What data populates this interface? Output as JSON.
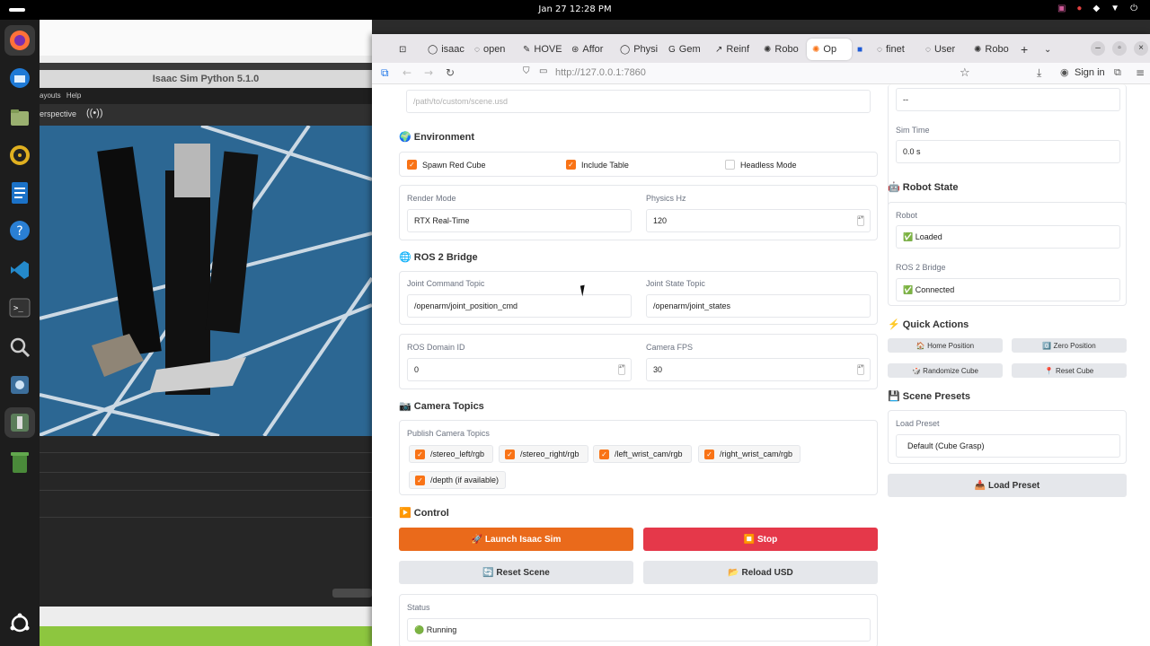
{
  "topbar": {
    "datetime": "Jan 27  12:28 PM",
    "tray": [
      "▣",
      "●",
      "◆",
      "▼",
      "⏻"
    ]
  },
  "dock": {
    "items": [
      "firefox-icon",
      "thunderbird-icon",
      "files-icon",
      "rhythmbox-icon",
      "writer-icon",
      "help-icon",
      "vscode-icon",
      "terminal-icon",
      "search-icon",
      "isaac-app-icon",
      "isaac-sim-icon",
      "trash-icon",
      "ubuntu-logo-icon"
    ]
  },
  "sim": {
    "title": "Isaac Sim Python 5.1.0",
    "menu": [
      "ayouts",
      "Help"
    ],
    "viewport_mode": "erspective",
    "camera_glyph": "((•))"
  },
  "browser": {
    "tabs": [
      {
        "icon": "⊡",
        "label": ""
      },
      {
        "icon": "◯",
        "label": "isaac"
      },
      {
        "icon": "◌",
        "label": "open"
      },
      {
        "icon": "✎",
        "label": "HOVE"
      },
      {
        "icon": "⊛",
        "label": "Affor"
      },
      {
        "icon": "◯",
        "label": "Physi"
      },
      {
        "icon": "G",
        "label": "Gem"
      },
      {
        "icon": "↗",
        "label": "Reinf"
      },
      {
        "icon": "✺",
        "label": "Robo"
      },
      {
        "icon": "✺",
        "label": "Op"
      },
      {
        "icon": "■",
        "label": ""
      },
      {
        "icon": "◌",
        "label": "finet"
      },
      {
        "icon": "◌",
        "label": "User"
      },
      {
        "icon": "✺",
        "label": "Robo"
      }
    ],
    "url": "http://127.0.0.1:7860",
    "sign_in": "Sign in"
  },
  "app": {
    "custom_scene_placeholder": "/path/to/custom/scene.usd",
    "environment": {
      "title": "🌍 Environment",
      "spawn_red_cube": "Spawn Red Cube",
      "include_table": "Include Table",
      "headless_mode": "Headless Mode",
      "render_mode_label": "Render Mode",
      "render_mode_value": "RTX Real-Time",
      "physics_hz_label": "Physics Hz",
      "physics_hz_value": "120"
    },
    "ros2": {
      "title": "🌐 ROS 2 Bridge",
      "joint_cmd_label": "Joint Command Topic",
      "joint_cmd_value": "/openarm/joint_position_cmd",
      "joint_state_label": "Joint State Topic",
      "joint_state_value": "/openarm/joint_states",
      "domain_label": "ROS Domain ID",
      "domain_value": "0",
      "camera_fps_label": "Camera FPS",
      "camera_fps_value": "30"
    },
    "camera_topics": {
      "title": "📷 Camera Topics",
      "label": "Publish Camera Topics",
      "items": [
        "/stereo_left/rgb",
        "/stereo_right/rgb",
        "/left_wrist_cam/rgb",
        "/right_wrist_cam/rgb",
        "/depth (if available)"
      ]
    },
    "control": {
      "title": "▶️ Control",
      "launch": "🚀 Launch Isaac Sim",
      "stop": "⏹️ Stop",
      "reset_scene": "🔄 Reset Scene",
      "reload_usd": "📂 Reload USD",
      "status_label": "Status",
      "status_value": "🟢 Running"
    },
    "right": {
      "top_value": "--",
      "sim_time_label": "Sim Time",
      "sim_time_value": "0.0 s",
      "robot_state_title": "🤖 Robot State",
      "robot_label": "Robot",
      "robot_value": "✅ Loaded",
      "ros2_bridge_label": "ROS 2 Bridge",
      "ros2_bridge_value": "✅ Connected",
      "quick_actions_title": "⚡ Quick Actions",
      "home_position": "🏠 Home Position",
      "zero_position": "0️⃣ Zero Position",
      "randomize_cube": "🎲 Randomize Cube",
      "reset_cube": "📍 Reset Cube",
      "scene_presets_title": "💾 Scene Presets",
      "load_preset_label": "Load Preset",
      "load_preset_value": "Default (Cube Grasp)",
      "load_preset_button": "📥 Load Preset"
    }
  }
}
